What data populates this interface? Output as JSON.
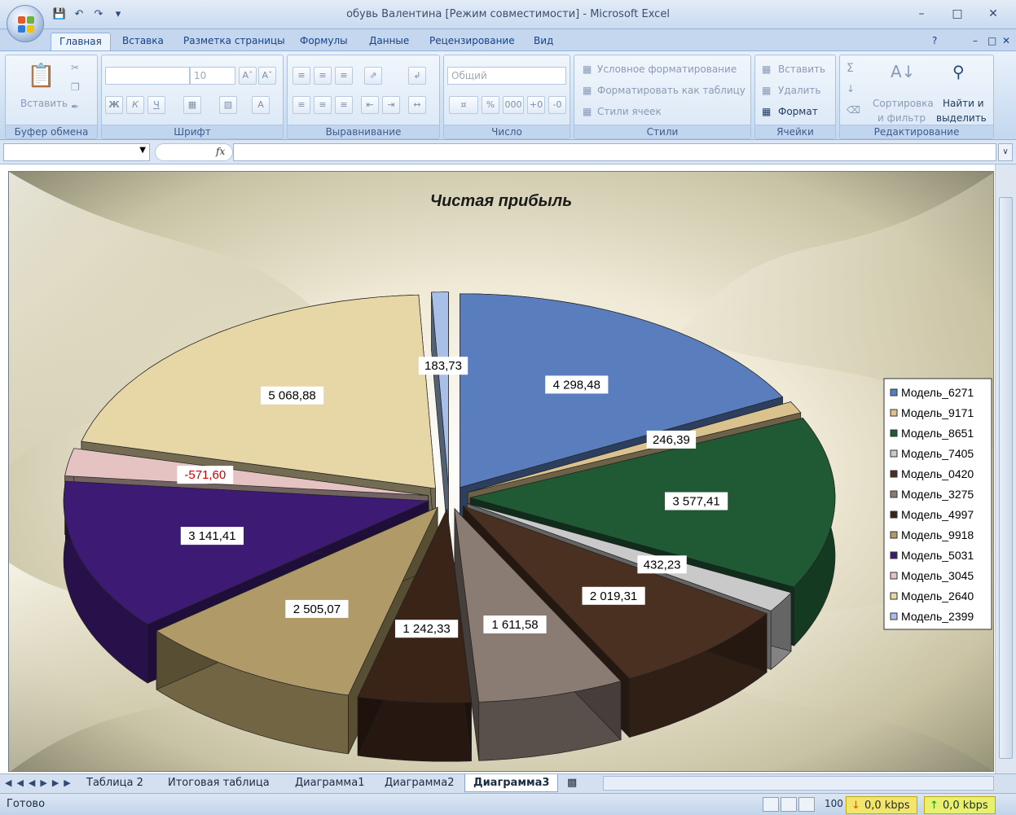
{
  "window": {
    "title": "обувь Валентина  [Режим совместимости]  -  Microsoft Excel"
  },
  "ribbon_tabs": [
    "Главная",
    "Вставка",
    "Разметка страницы",
    "Формулы",
    "Данные",
    "Рецензирование",
    "Вид"
  ],
  "ribbon": {
    "clipboard": {
      "label": "Буфер обмена",
      "paste": "Вставить"
    },
    "font": {
      "label": "Шрифт",
      "size": "10",
      "bold": "Ж",
      "italic": "К",
      "underline": "Ч"
    },
    "alignment": {
      "label": "Выравнивание"
    },
    "number": {
      "label": "Число",
      "format": "Общий",
      "percent": "%",
      "thousands": "000"
    },
    "styles": {
      "label": "Стили",
      "conditional": "Условное форматирование",
      "as_table": "Форматировать как таблицу",
      "cell_styles": "Стили ячеек"
    },
    "cells": {
      "label": "Ячейки",
      "insert": "Вставить",
      "delete": "Удалить",
      "format": "Формат"
    },
    "editing": {
      "label": "Редактирование",
      "sort1": "Сортировка",
      "sort2": "и фильтр",
      "find1": "Найти и",
      "find2": "выделить"
    }
  },
  "formula_bar": {
    "fx": "fx"
  },
  "chart_data": {
    "type": "pie",
    "title": "Чистая прибыль",
    "categories": [
      "Модель_6271",
      "Модель_9171",
      "Модель_8651",
      "Модель_7405",
      "Модель_0420",
      "Модель_3275",
      "Модель_4997",
      "Модель_9918",
      "Модель_5031",
      "Модель_3045",
      "Модель_2640",
      "Модель_2399"
    ],
    "values": [
      4298.48,
      246.39,
      3577.41,
      432.23,
      2019.31,
      1611.58,
      1242.33,
      2505.07,
      3141.41,
      -571.6,
      5068.88,
      183.73
    ],
    "data_labels": [
      "4 298,48",
      "246,39",
      "3 577,41",
      "432,23",
      "2 019,31",
      "1 611,58",
      "1 242,33",
      "2 505,07",
      "3 141,41",
      "-571,60",
      "5 068,88",
      "183,73"
    ],
    "colors": [
      "#5a7dbe",
      "#d9c28e",
      "#1f5a35",
      "#c9c9c9",
      "#4a3020",
      "#8a7b73",
      "#3a2418",
      "#b09b68",
      "#3d1a73",
      "#e6c3c3",
      "#e7d6a6",
      "#a8c0e8"
    ],
    "legend_position": "right",
    "style": "3d-exploded"
  },
  "sheet_tabs": [
    "Таблица 2",
    "Итоговая таблица",
    "Диаграмма1",
    "Диаграмма2",
    "Диаграмма3"
  ],
  "active_sheet": "Диаграмма3",
  "status": {
    "text": "Готово",
    "zoom": "100",
    "down_speed": "0,0 kbps",
    "up_speed": "0,0 kbps"
  }
}
